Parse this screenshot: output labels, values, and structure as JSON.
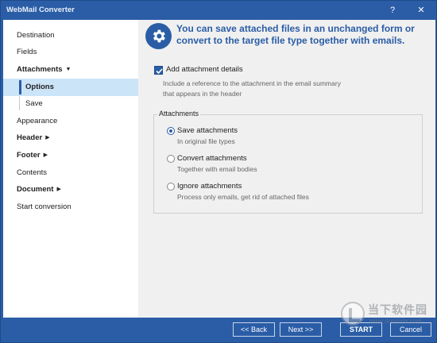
{
  "window": {
    "title": "WebMail Converter",
    "help_label": "?",
    "close_label": "✕"
  },
  "sidebar": {
    "items": [
      {
        "label": "Destination"
      },
      {
        "label": "Fields"
      },
      {
        "label": "Attachments"
      },
      {
        "label": "Options"
      },
      {
        "label": "Save"
      },
      {
        "label": "Appearance"
      },
      {
        "label": "Header"
      },
      {
        "label": "Footer"
      },
      {
        "label": "Contents"
      },
      {
        "label": "Document"
      },
      {
        "label": "Start conversion"
      }
    ],
    "active": "Options"
  },
  "main": {
    "header_text": "You can save attached files in an unchanged form or convert to the target file type together with emails.",
    "add_details": {
      "label": "Add attachment details",
      "checked": true,
      "description": "Include a reference to the attachment in the email summary that appears in the header"
    },
    "group": {
      "title": "Attachments",
      "options": [
        {
          "label": "Save attachments",
          "description": "In original file types",
          "selected": true
        },
        {
          "label": "Convert attachments",
          "description": "Together with email bodies",
          "selected": false
        },
        {
          "label": "Ignore attachments",
          "description": "Process only emails, get rid of attached files",
          "selected": false
        }
      ]
    }
  },
  "footer": {
    "back_label": "<< Back",
    "next_label": "Next >>",
    "start_label": "START",
    "cancel_label": "Cancel"
  },
  "watermark": {
    "text_cn": "当下软件园",
    "url": "www.downxia.com"
  },
  "colors": {
    "accent": "#2a5da6",
    "selection": "#cce4f7",
    "panel": "#f0f0f0"
  }
}
